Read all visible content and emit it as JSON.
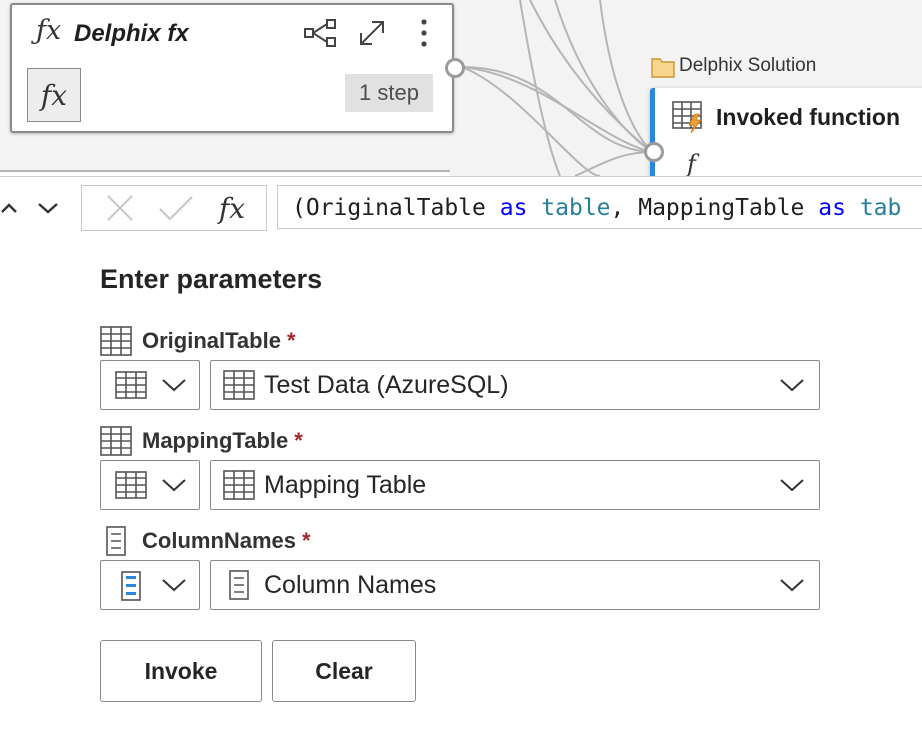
{
  "diagram": {
    "fx_card": {
      "icon": "function-icon",
      "title": "Delphix fx",
      "fx_glyph": "fx",
      "step_badge": "1 step",
      "actions": [
        "share-diagram-icon",
        "expand-icon",
        "more-options-icon"
      ]
    },
    "folder": {
      "icon": "folder-icon",
      "label": "Delphix Solution"
    },
    "invoked_card": {
      "icon": "table-lightning-icon",
      "title": "Invoked function",
      "fx_glyph": "f"
    }
  },
  "formula_bar": {
    "nav": [
      "chevron-up-icon",
      "chevron-down-icon"
    ],
    "cancel_icon": "close-icon",
    "commit_icon": "check-icon",
    "fx_label": "fx",
    "formula": {
      "p1": "(OriginalTable ",
      "kw1": "as",
      "sp1": " ",
      "ty1": "table",
      "p2": ", MappingTable ",
      "kw2": "as",
      "sp2": " ",
      "ty2": "tab"
    }
  },
  "params": {
    "heading": "Enter parameters",
    "required_mark": "*",
    "items": [
      {
        "label": "OriginalTable",
        "label_icon": "table-icon",
        "type_icon": "table-icon",
        "value_icon": "table-icon",
        "value": "Test Data (AzureSQL)"
      },
      {
        "label": "MappingTable",
        "label_icon": "table-icon",
        "type_icon": "table-icon",
        "value_icon": "table-icon",
        "value": "Mapping Table"
      },
      {
        "label": "ColumnNames",
        "label_icon": "list-icon",
        "type_icon": "list-icon",
        "value_icon": "list-icon",
        "value": "Column Names"
      }
    ]
  },
  "buttons": {
    "invoke": "Invoke",
    "clear": "Clear"
  },
  "colors": {
    "accent": "#2b88d8",
    "required": "#a4262c",
    "keyword": "#0000ff",
    "type": "#267f99",
    "folder": "#f2c66f"
  }
}
